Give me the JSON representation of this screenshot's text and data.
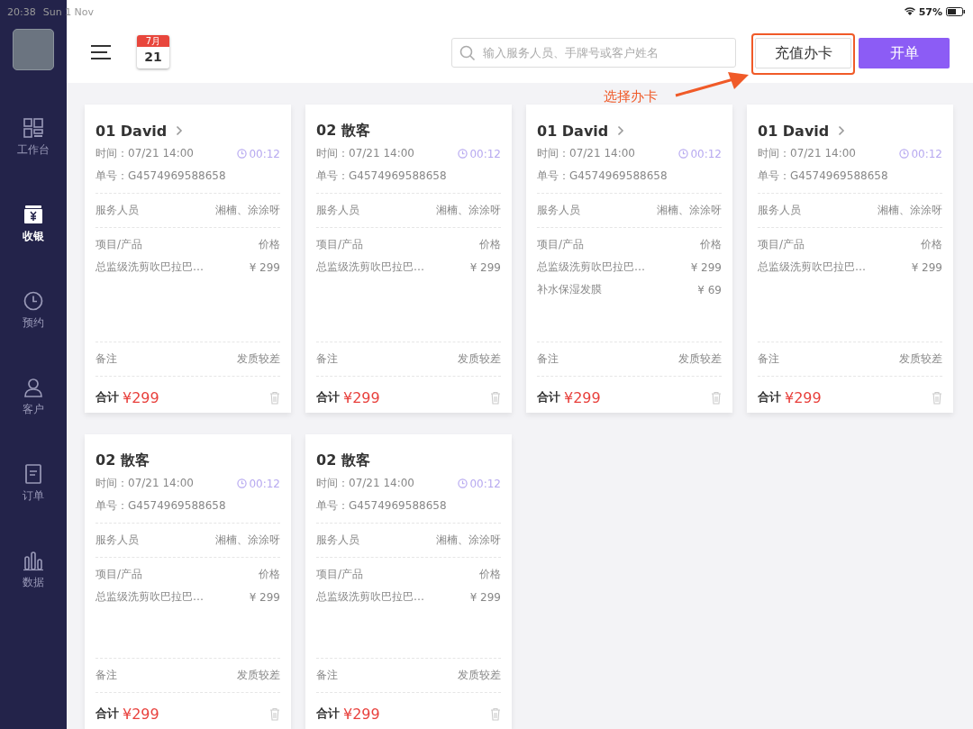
{
  "status_bar": {
    "time": "20:38",
    "date": "Sun 1 Nov",
    "battery": "57%"
  },
  "sidebar": {
    "items": [
      {
        "label": "工作台",
        "selected": false
      },
      {
        "label": "收银",
        "selected": true
      },
      {
        "label": "预约",
        "selected": false
      },
      {
        "label": "客户",
        "selected": false
      },
      {
        "label": "订单",
        "selected": false
      },
      {
        "label": "数据",
        "selected": false
      }
    ]
  },
  "toolbar": {
    "calendar": {
      "month": "7月",
      "day": "21"
    },
    "search": {
      "placeholder": "输入服务人员、手牌号或客户姓名"
    },
    "buttons": [
      {
        "label": "充值办卡",
        "kind": "outline",
        "highlighted": true
      },
      {
        "label": "开单",
        "kind": "primary",
        "highlighted": false
      }
    ]
  },
  "annotation": {
    "text": "选择办卡"
  },
  "cards": [
    {
      "title": "01 David",
      "chevron": true,
      "time": "时间：07/21 14:00",
      "duration": "00:12",
      "order_no": "单号：G4574969588658",
      "staff_label": "服务人员",
      "staff": "湘楠、涂涂呀",
      "items_label": "项目/产品",
      "price_label": "价格",
      "items": [
        {
          "name": "总监级洗剪吹巴拉巴…",
          "price": "¥ 299"
        }
      ],
      "note_label": "备注",
      "note": "发质较差",
      "total_label": "合计",
      "total": "¥299"
    },
    {
      "title": "02 散客",
      "chevron": false,
      "time": "时间：07/21 14:00",
      "duration": "00:12",
      "order_no": "单号：G4574969588658",
      "staff_label": "服务人员",
      "staff": "湘楠、涂涂呀",
      "items_label": "项目/产品",
      "price_label": "价格",
      "items": [
        {
          "name": "总监级洗剪吹巴拉巴…",
          "price": "¥ 299"
        }
      ],
      "note_label": "备注",
      "note": "发质较差",
      "total_label": "合计",
      "total": "¥299"
    },
    {
      "title": "01 David",
      "chevron": true,
      "time": "时间：07/21 14:00",
      "duration": "00:12",
      "order_no": "单号：G4574969588658",
      "staff_label": "服务人员",
      "staff": "湘楠、涂涂呀",
      "items_label": "项目/产品",
      "price_label": "价格",
      "items": [
        {
          "name": "总监级洗剪吹巴拉巴…",
          "price": "¥ 299"
        },
        {
          "name": "补水保湿发膜",
          "price": "¥ 69"
        }
      ],
      "note_label": "备注",
      "note": "发质较差",
      "total_label": "合计",
      "total": "¥299"
    },
    {
      "title": "01 David",
      "chevron": true,
      "time": "时间：07/21 14:00",
      "duration": "00:12",
      "order_no": "单号：G4574969588658",
      "staff_label": "服务人员",
      "staff": "湘楠、涂涂呀",
      "items_label": "项目/产品",
      "price_label": "价格",
      "items": [
        {
          "name": "总监级洗剪吹巴拉巴…",
          "price": "¥ 299"
        }
      ],
      "note_label": "备注",
      "note": "发质较差",
      "total_label": "合计",
      "total": "¥299"
    },
    {
      "title": "02 散客",
      "chevron": false,
      "time": "时间：07/21 14:00",
      "duration": "00:12",
      "order_no": "单号：G4574969588658",
      "staff_label": "服务人员",
      "staff": "湘楠、涂涂呀",
      "items_label": "项目/产品",
      "price_label": "价格",
      "items": [
        {
          "name": "总监级洗剪吹巴拉巴…",
          "price": "¥ 299"
        }
      ],
      "note_label": "备注",
      "note": "发质较差",
      "total_label": "合计",
      "total": "¥299"
    },
    {
      "title": "02 散客",
      "chevron": false,
      "time": "时间：07/21 14:00",
      "duration": "00:12",
      "order_no": "单号：G4574969588658",
      "staff_label": "服务人员",
      "staff": "湘楠、涂涂呀",
      "items_label": "项目/产品",
      "price_label": "价格",
      "items": [
        {
          "name": "总监级洗剪吹巴拉巴…",
          "price": "¥ 299"
        }
      ],
      "note_label": "备注",
      "note": "发质较差",
      "total_label": "合计",
      "total": "¥299"
    }
  ]
}
